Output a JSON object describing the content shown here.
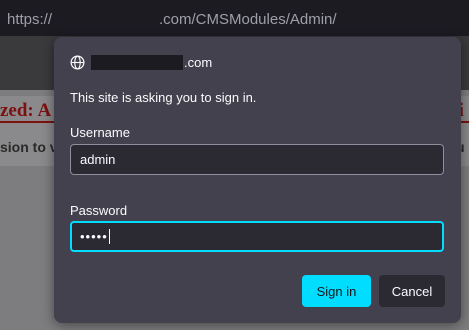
{
  "browser": {
    "url_prefix": "https://",
    "url_suffix": ".com/CMSModules/Admin/"
  },
  "background_page": {
    "error_left": "zed: A",
    "error_right": "ki",
    "sub_left": "sion to v",
    "sub_right": "u"
  },
  "dialog": {
    "site_domain": ".com",
    "prompt": "This site is asking you to sign in.",
    "username_label": "Username",
    "username_value": "admin",
    "password_label": "Password",
    "password_masked": "•••••",
    "signin_label": "Sign in",
    "cancel_label": "Cancel",
    "globe_icon": "globe-icon"
  },
  "colors": {
    "accent": "#00ddff",
    "dialog_bg": "#42414d",
    "input_bg": "#2b2a33",
    "error_red": "#7e1010"
  }
}
